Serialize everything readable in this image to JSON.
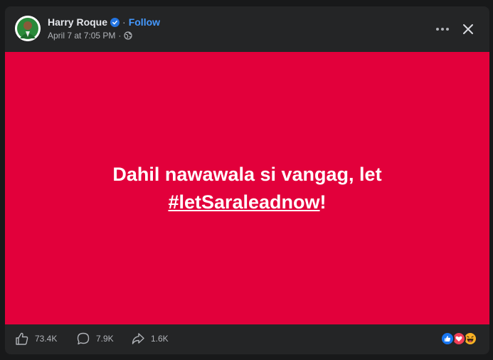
{
  "post": {
    "author": "Harry Roque",
    "follow_label": "Follow",
    "separator": "·",
    "timestamp": "April 7 at 7:05 PM",
    "audience_icon": "globe-icon",
    "text_main": "Dahil nawawala si vangag, let",
    "hashtag": "#letSaraleadnow",
    "text_end": "!",
    "media_background": "#e2003b"
  },
  "stats": {
    "likes": "73.4K",
    "comments": "7.9K",
    "shares": "1.6K"
  },
  "reactions": [
    "like-icon",
    "love-icon",
    "haha-icon"
  ],
  "colors": {
    "page_bg": "#18191a",
    "card_bg": "#242526",
    "primary_text": "#e4e6eb",
    "secondary_text": "#b0b3b8",
    "link": "#4599ff",
    "verified": "#2374e1"
  }
}
